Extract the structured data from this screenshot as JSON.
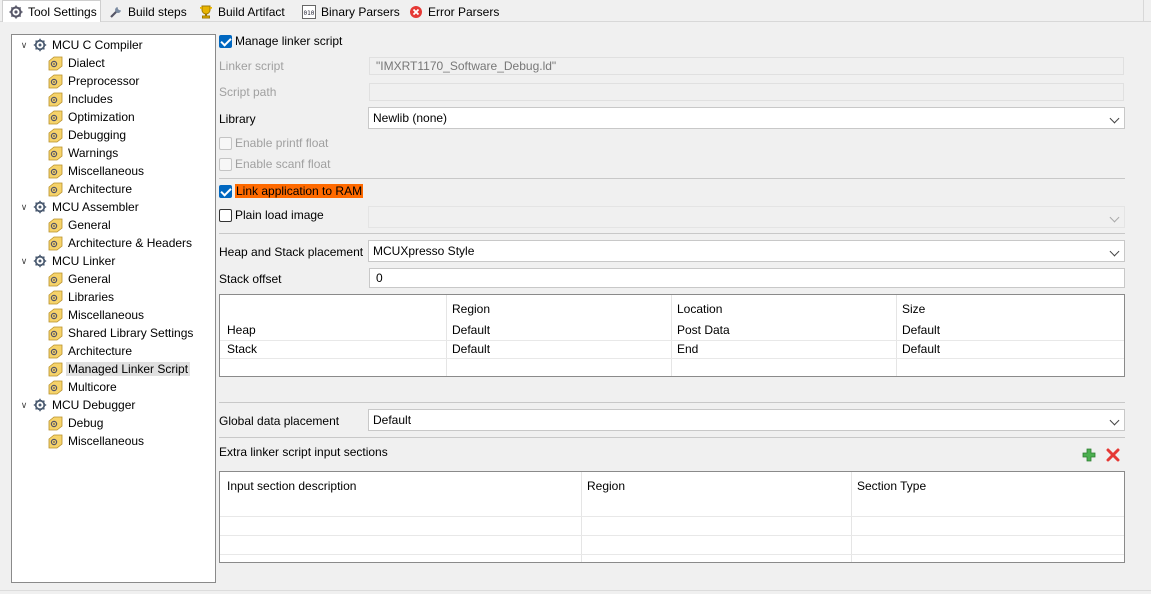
{
  "tabs": [
    {
      "label": "Tool Settings",
      "icon": "gear-icon",
      "active": true
    },
    {
      "label": "Build steps",
      "icon": "wrench-icon"
    },
    {
      "label": "Build Artifact",
      "icon": "trophy-icon"
    },
    {
      "label": "Binary Parsers",
      "icon": "binary-icon"
    },
    {
      "label": "Error Parsers",
      "icon": "error-icon"
    }
  ],
  "tree": {
    "groups": [
      {
        "label": "MCU C Compiler",
        "children": [
          "Dialect",
          "Preprocessor",
          "Includes",
          "Optimization",
          "Debugging",
          "Warnings",
          "Miscellaneous",
          "Architecture"
        ]
      },
      {
        "label": "MCU Assembler",
        "children": [
          "General",
          "Architecture & Headers"
        ]
      },
      {
        "label": "MCU Linker",
        "children": [
          "General",
          "Libraries",
          "Miscellaneous",
          "Shared Library Settings",
          "Architecture",
          "Managed Linker Script",
          "Multicore"
        ]
      },
      {
        "label": "MCU Debugger",
        "children": [
          "Debug",
          "Miscellaneous"
        ]
      }
    ],
    "selected": "Managed Linker Script"
  },
  "settings": {
    "manage_linker_script": {
      "label": "Manage linker script",
      "checked": true
    },
    "linker_script": {
      "label": "Linker script",
      "value": "\"IMXRT1170_Software_Debug.ld\""
    },
    "script_path": {
      "label": "Script path",
      "value": ""
    },
    "library": {
      "label": "Library",
      "value": "Newlib (none)"
    },
    "enable_printf_float": {
      "label": "Enable printf float",
      "checked": false
    },
    "enable_scanf_float": {
      "label": "Enable scanf float",
      "checked": false
    },
    "link_to_ram": {
      "label": "Link application to RAM",
      "checked": true
    },
    "plain_load_image": {
      "label": "Plain load image",
      "checked": false,
      "value": ""
    },
    "heap_stack_placement": {
      "label": "Heap and Stack placement",
      "value": "MCUXpresso Style"
    },
    "stack_offset": {
      "label": "Stack offset",
      "value": "0"
    },
    "heap_stack_table": {
      "columns": [
        "",
        "Region",
        "Location",
        "Size"
      ],
      "rows": [
        [
          "Heap",
          "Default",
          "Post Data",
          "Default"
        ],
        [
          "Stack",
          "Default",
          "End",
          "Default"
        ]
      ]
    },
    "global_data_placement": {
      "label": "Global data placement",
      "value": "Default"
    },
    "extra_sections": {
      "label": "Extra linker script input sections",
      "columns": [
        "Input section description",
        "Region",
        "Section Type"
      ],
      "add_icon": "add-icon",
      "remove_icon": "delete-icon"
    }
  },
  "colors": {
    "accent": "#0067c0",
    "highlight": "#ff6a00"
  }
}
